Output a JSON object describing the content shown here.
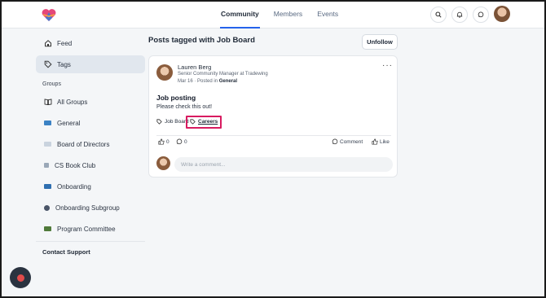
{
  "header": {
    "tabs": [
      {
        "label": "Community",
        "active": true
      },
      {
        "label": "Members",
        "active": false
      },
      {
        "label": "Events",
        "active": false
      }
    ],
    "icons": [
      "search-icon",
      "bell-icon",
      "chat-icon"
    ]
  },
  "sidebar": {
    "items": [
      {
        "label": "Feed",
        "icon": "home-icon"
      },
      {
        "label": "Tags",
        "icon": "tag-icon",
        "active": true
      }
    ],
    "groups_label": "Groups",
    "groups": [
      {
        "label": "All Groups",
        "icon": "book-icon"
      },
      {
        "label": "General",
        "icon": "group-thumbnail",
        "color": "#3b82c4"
      },
      {
        "label": "Board of Directors",
        "icon": "group-thumbnail",
        "color": "#c9d3de"
      },
      {
        "label": "CS Book Club",
        "icon": "group-thumbnail",
        "color": "#9aa8b8"
      },
      {
        "label": "Onboarding",
        "icon": "group-thumbnail",
        "color": "#2f6fb0"
      },
      {
        "label": "Onboarding Subgroup",
        "icon": "group-thumbnail",
        "color": "#4a5568"
      },
      {
        "label": "Program Committee",
        "icon": "group-thumbnail",
        "color": "#4f7a3a"
      }
    ],
    "support": "Contact Support"
  },
  "main": {
    "title": "Posts tagged with Job Board",
    "unfollow_label": "Unfollow",
    "post": {
      "author": "Lauren Berg",
      "author_title": "Senior Community Manager at Tradewing",
      "date": "Mar 16",
      "posted_in_prefix": "· Posted in",
      "group": "General",
      "title": "Job posting",
      "body": "Please check this out!",
      "tags": [
        "Job Board",
        "Careers"
      ],
      "likes_count": "0",
      "comments_count": "0",
      "comment_label": "Comment",
      "like_label": "Like",
      "comment_placeholder": "Write a comment..."
    }
  },
  "colors": {
    "accent": "#2563eb",
    "highlight": "#d81b60",
    "fab": "#2a3340"
  }
}
